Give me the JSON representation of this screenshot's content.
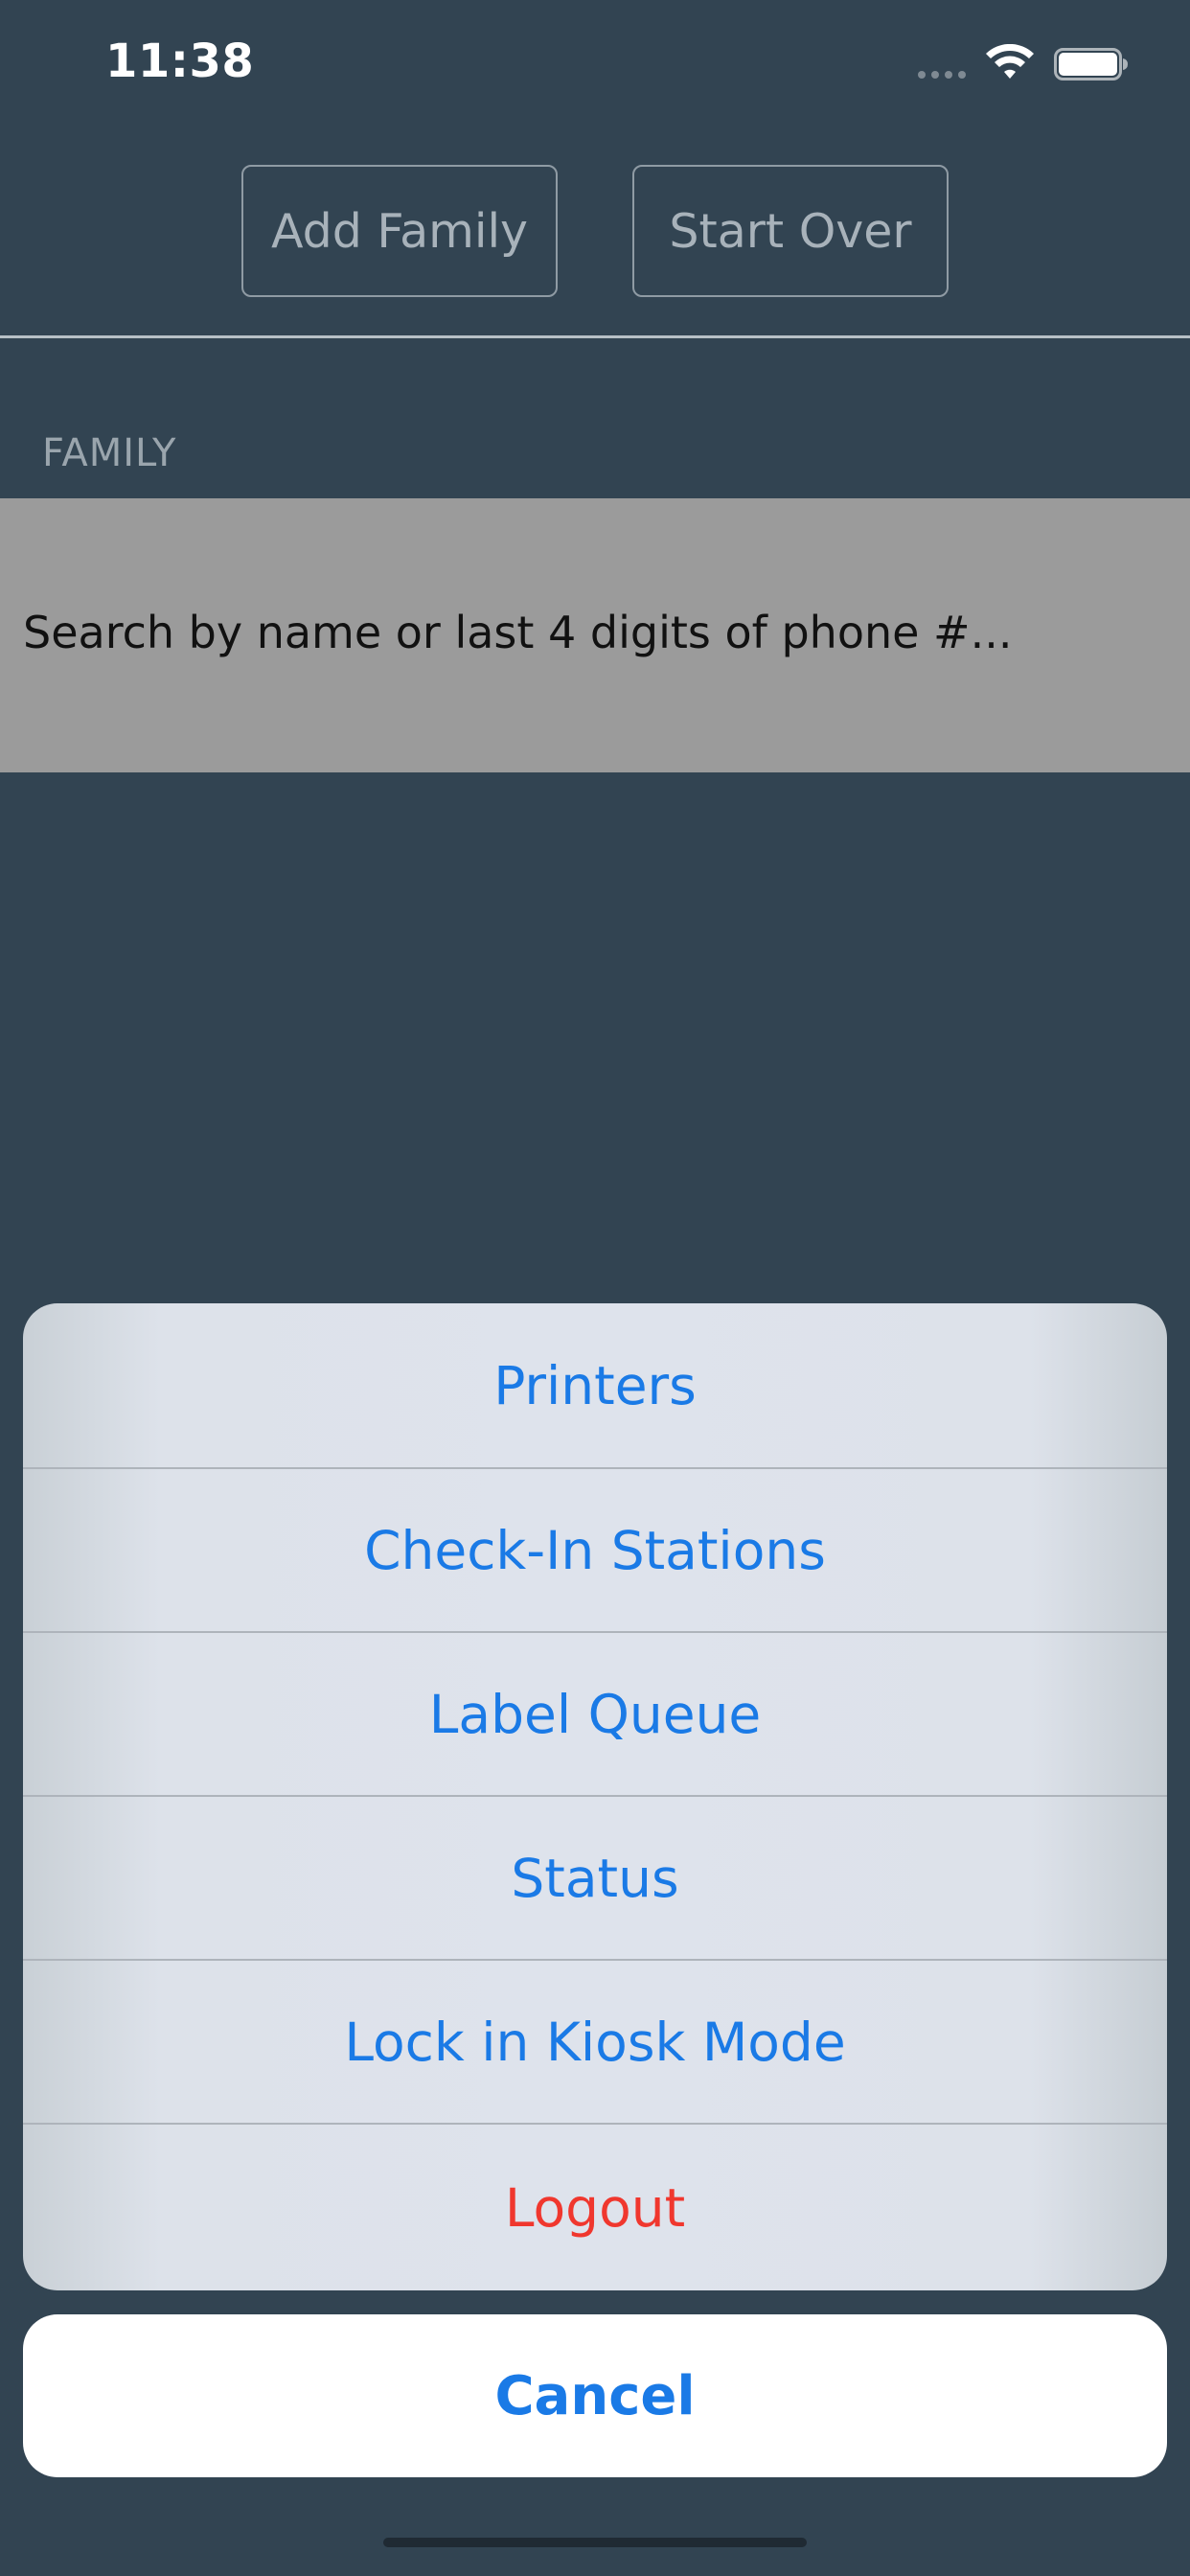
{
  "status_bar": {
    "time": "11:38",
    "icons": [
      "signal-icon",
      "wifi-icon",
      "battery-icon"
    ]
  },
  "header": {
    "add_family_label": "Add Family",
    "start_over_label": "Start Over"
  },
  "family_section": {
    "label": "FAMILY",
    "search_placeholder": "Search by name or last 4 digits of phone #..."
  },
  "action_sheet": {
    "items": [
      {
        "label": "Printers"
      },
      {
        "label": "Check-In Stations"
      },
      {
        "label": "Label Queue"
      },
      {
        "label": "Status"
      },
      {
        "label": "Lock in Kiosk Mode"
      },
      {
        "label": "Logout"
      }
    ],
    "cancel_label": "Cancel"
  },
  "colors": {
    "background": "#324452",
    "action_blue": "#1a7ae6",
    "destructive_red": "#f0372e",
    "search_row": "#9b9b9b"
  }
}
